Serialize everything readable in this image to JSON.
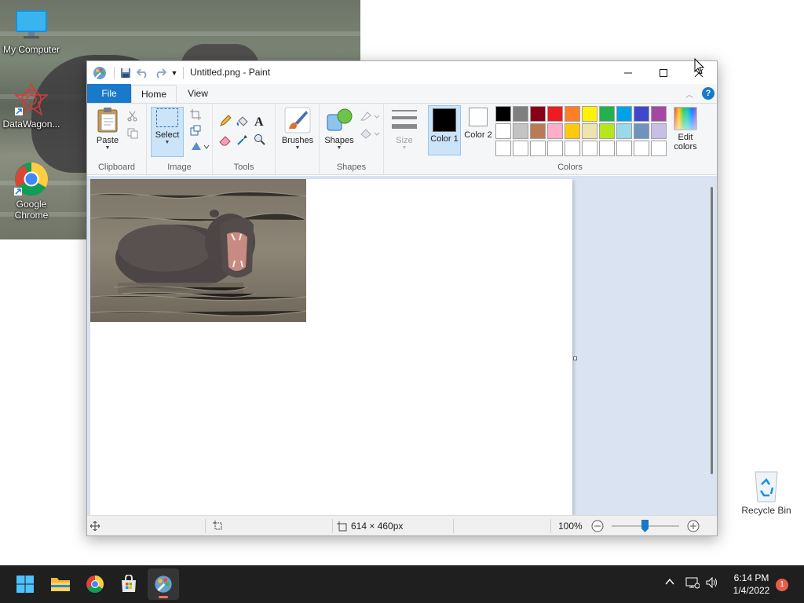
{
  "desktop": {
    "icons": [
      {
        "label": "My Computer"
      },
      {
        "label": "DataWagon..."
      },
      {
        "label": "Google Chrome"
      },
      {
        "label": "Recycle Bin"
      }
    ]
  },
  "paint": {
    "title": "Untitled.png - Paint",
    "tabs": {
      "file": "File",
      "home": "Home",
      "view": "View"
    },
    "clipboard": {
      "paste": "Paste",
      "group": "Clipboard"
    },
    "image": {
      "select": "Select",
      "group": "Image"
    },
    "tools": {
      "group": "Tools"
    },
    "brushes": {
      "label": "Brushes"
    },
    "shapes": {
      "label": "Shapes",
      "group": "Shapes"
    },
    "size": {
      "label": "Size"
    },
    "colors": {
      "color1_label": "Color 1",
      "color2_label": "Color 2",
      "color1": "#000000",
      "color2": "#ffffff",
      "edit_colors": "Edit colors",
      "group": "Colors",
      "palette_row1": [
        "#000000",
        "#7f7f7f",
        "#880015",
        "#ed1c24",
        "#ff7f27",
        "#fff200",
        "#22b14c",
        "#00a2e8",
        "#3f48cc",
        "#a349a4"
      ],
      "palette_row2": [
        "#ffffff",
        "#c3c3c3",
        "#b97a57",
        "#ffaec9",
        "#ffc90e",
        "#efe4b0",
        "#b5e61d",
        "#99d9ea",
        "#7092be",
        "#c8bfe7"
      ]
    },
    "status": {
      "dimensions": "614 × 460px",
      "zoom": "100%",
      "zoom_level": 100
    }
  },
  "taskbar": {
    "time": "6:14 PM",
    "date": "1/4/2022",
    "notification_count": "1"
  }
}
